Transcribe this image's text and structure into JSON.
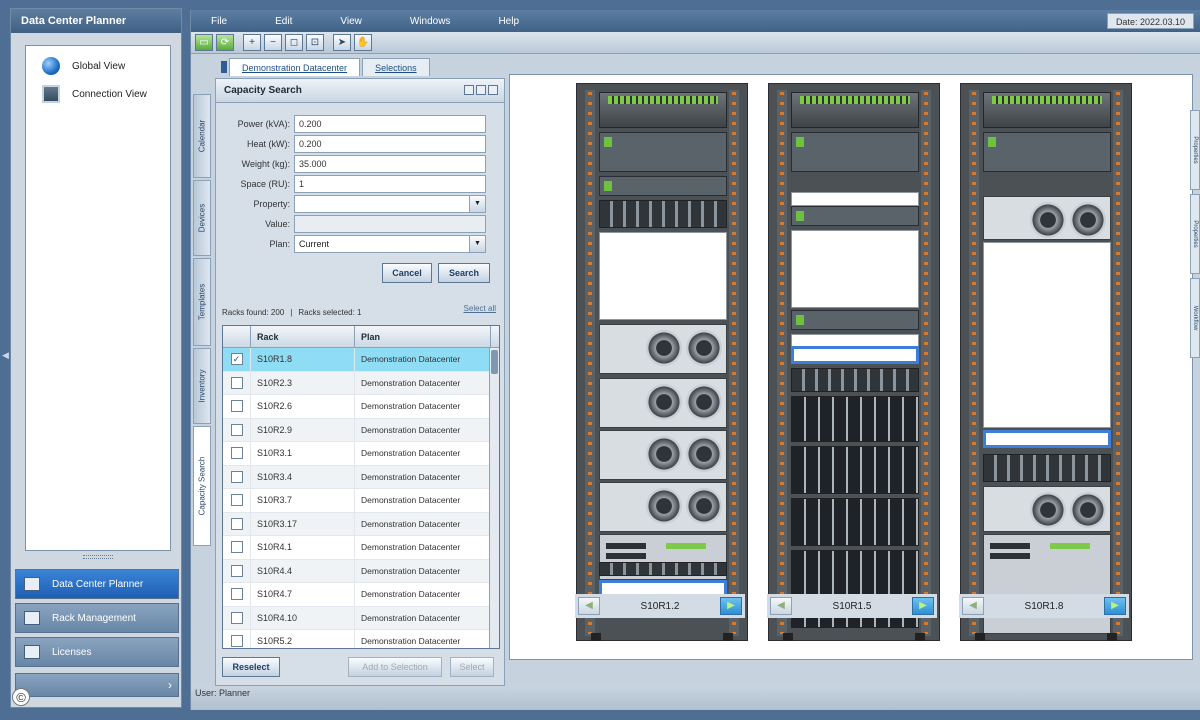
{
  "left_panel": {
    "title": "Data Center Planner",
    "tree": [
      {
        "label": "Global View",
        "icon": "globe-icon"
      },
      {
        "label": "Connection View",
        "icon": "connection-icon"
      }
    ],
    "nav_buttons": [
      {
        "label": "Data Center Planner",
        "active": true
      },
      {
        "label": "Rack Management",
        "active": false
      },
      {
        "label": "Licenses",
        "active": false
      }
    ],
    "copyright_symbol": "©"
  },
  "menubar": {
    "items": [
      "File",
      "Edit",
      "View",
      "Windows",
      "Help"
    ],
    "status_date": "Date: 2022.03.10"
  },
  "tabs": [
    "Demonstration Datacenter",
    "Selections"
  ],
  "side_tabs": [
    "Calendar",
    "Devices",
    "Templates",
    "Inventory",
    "Capacity Search"
  ],
  "capacity_search": {
    "title": "Capacity Search",
    "fields": [
      {
        "label": "Power (kVA):",
        "value": "0.200"
      },
      {
        "label": "Heat (kW):",
        "value": "0.200"
      },
      {
        "label": "Weight (kg):",
        "value": "35.000"
      },
      {
        "label": "Space (RU):",
        "value": "1"
      }
    ],
    "property_label": "Property:",
    "value_label": "Value:",
    "plan_label": "Plan:",
    "plan_value": "Current",
    "cancel": "Cancel",
    "search": "Search",
    "result_info": {
      "searched": "Racks found: 200",
      "selected": "Racks selected: 1",
      "link": "Select all"
    },
    "columns": [
      "Rack",
      "Plan"
    ],
    "rows": [
      {
        "rack": "S10R1.8",
        "plan": "Demonstration Datacenter",
        "checked": true
      },
      {
        "rack": "S10R2.3",
        "plan": "Demonstration Datacenter",
        "checked": false
      },
      {
        "rack": "S10R2.6",
        "plan": "Demonstration Datacenter",
        "checked": false
      },
      {
        "rack": "S10R2.9",
        "plan": "Demonstration Datacenter",
        "checked": false
      },
      {
        "rack": "S10R3.1",
        "plan": "Demonstration Datacenter",
        "checked": false
      },
      {
        "rack": "S10R3.4",
        "plan": "Demonstration Datacenter",
        "checked": false
      },
      {
        "rack": "S10R3.7",
        "plan": "Demonstration Datacenter",
        "checked": false
      },
      {
        "rack": "S10R3.17",
        "plan": "Demonstration Datacenter",
        "checked": false
      },
      {
        "rack": "S10R4.1",
        "plan": "Demonstration Datacenter",
        "checked": false
      },
      {
        "rack": "S10R4.4",
        "plan": "Demonstration Datacenter",
        "checked": false
      },
      {
        "rack": "S10R4.7",
        "plan": "Demonstration Datacenter",
        "checked": false
      },
      {
        "rack": "S10R4.10",
        "plan": "Demonstration Datacenter",
        "checked": false
      },
      {
        "rack": "S10R5.2",
        "plan": "Demonstration Datacenter",
        "checked": false
      }
    ],
    "reselect": "Reselect",
    "add_to_selection": "Add to Selection",
    "select": "Select"
  },
  "racks": [
    {
      "name": "S10R1.2"
    },
    {
      "name": "S10R1.5"
    },
    {
      "name": "S10R1.8"
    }
  ],
  "right_tabs": [
    "Properties",
    "Properties",
    "Workflow"
  ],
  "status_user": "User: Planner"
}
